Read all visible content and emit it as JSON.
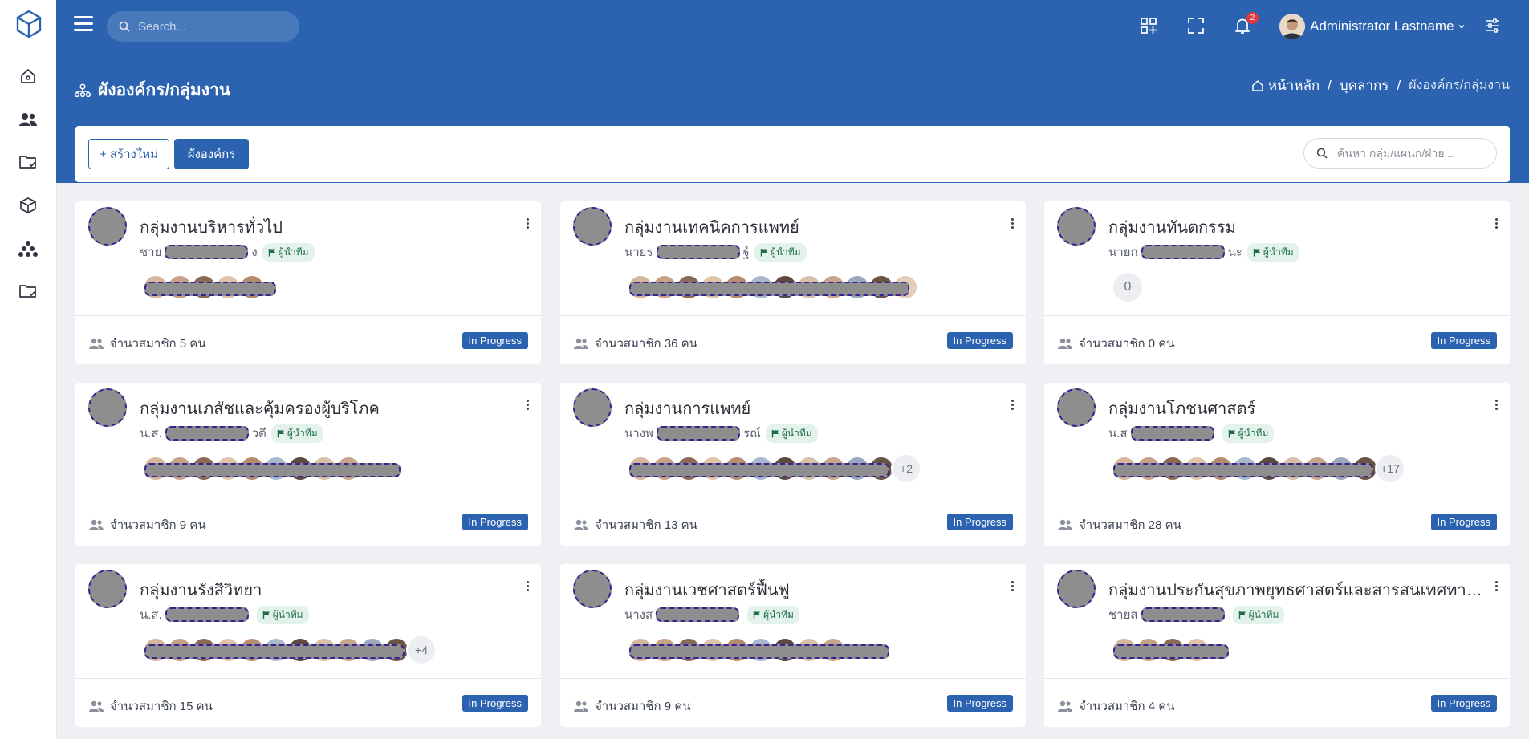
{
  "app": {
    "logo_icon": "cube-logo-icon",
    "accent": "#2b63b0",
    "status_color": "#2b63b0"
  },
  "sidebar": {
    "items": [
      {
        "name": "sidebar-item-home",
        "icon": "home-icon"
      },
      {
        "name": "sidebar-item-people",
        "icon": "people-icon"
      },
      {
        "name": "sidebar-item-folder",
        "icon": "folder-check-icon"
      },
      {
        "name": "sidebar-item-box",
        "icon": "box-icon"
      },
      {
        "name": "sidebar-item-org",
        "icon": "org-structure-icon"
      },
      {
        "name": "sidebar-item-folder-2",
        "icon": "folder-check-icon"
      }
    ]
  },
  "topbar": {
    "search_placeholder": "Search...",
    "notifications_count": "2",
    "user_name": "Administrator Lastname"
  },
  "header": {
    "title": "ผังองค์กร/กลุ่มงาน",
    "breadcrumb": [
      "หน้าหลัก",
      "บุคลากร",
      "ผังองค์กร/กลุ่มงาน"
    ]
  },
  "toolbar": {
    "create_label": "+ สร้างใหม่",
    "org_chart_label": "ผังองค์กร",
    "search_placeholder": "ค้นหา กลุ่ม/แผนก/ฝ่าย..."
  },
  "leader_badge_label": "ผู้นำทีม",
  "cards": [
    {
      "title": "กลุ่มงานบริหารทั่วไป",
      "leader_prefix": "ชาย",
      "leader_suffix": "ง",
      "member_avatars": 5,
      "more": "",
      "member_count": "จำนวสมาชิก 5 คน",
      "status": "In Progress"
    },
    {
      "title": "กลุ่มงานเทคนิคการแพทย์",
      "leader_prefix": "นายร",
      "leader_suffix": "ฐ์",
      "member_avatars": 12,
      "more": "",
      "member_count": "จำนวสมาชิก 36 คน",
      "status": "In Progress"
    },
    {
      "title": "กลุ่มงานทันตกรรม",
      "leader_prefix": "นายก",
      "leader_suffix": "นะ",
      "member_avatars": 0,
      "more": "0",
      "member_count": "จำนวสมาชิก 0 คน",
      "status": "In Progress"
    },
    {
      "title": "กลุ่มงานเภสัชและคุ้มครองผู้บริโภค",
      "leader_prefix": "น.ส.",
      "leader_suffix": "วดี",
      "member_avatars": 9,
      "more": "",
      "member_count": "จำนวสมาชิก 9 คน",
      "status": "In Progress"
    },
    {
      "title": "กลุ่มงานการแพทย์",
      "leader_prefix": "นางพ",
      "leader_suffix": "รณ์",
      "member_avatars": 11,
      "more": "+2",
      "member_count": "จำนวสมาชิก 13 คน",
      "status": "In Progress"
    },
    {
      "title": "กลุ่มงานโภชนศาสตร์",
      "leader_prefix": "น.ส",
      "leader_suffix": "",
      "member_avatars": 11,
      "more": "+17",
      "member_count": "จำนวสมาชิก 28 คน",
      "status": "In Progress"
    },
    {
      "title": "กลุ่มงานรังสีวิทยา",
      "leader_prefix": "น.ส.",
      "leader_suffix": "",
      "member_avatars": 11,
      "more": "+4",
      "member_count": "จำนวสมาชิก 15 คน",
      "status": "In Progress"
    },
    {
      "title": "กลุ่มงานเวชศาสตร์ฟื้นฟู",
      "leader_prefix": "นางส",
      "leader_suffix": "",
      "member_avatars": 9,
      "more": "",
      "member_count": "จำนวสมาชิก 9 คน",
      "status": "In Progress"
    },
    {
      "title": "กลุ่มงานประกันสุขภาพยุทธศาสตร์และสารสนเทศทางการ...",
      "leader_prefix": "ชายส",
      "leader_suffix": "",
      "member_avatars": 4,
      "more": "",
      "member_count": "จำนวสมาชิก 4 คน",
      "status": "In Progress"
    }
  ]
}
